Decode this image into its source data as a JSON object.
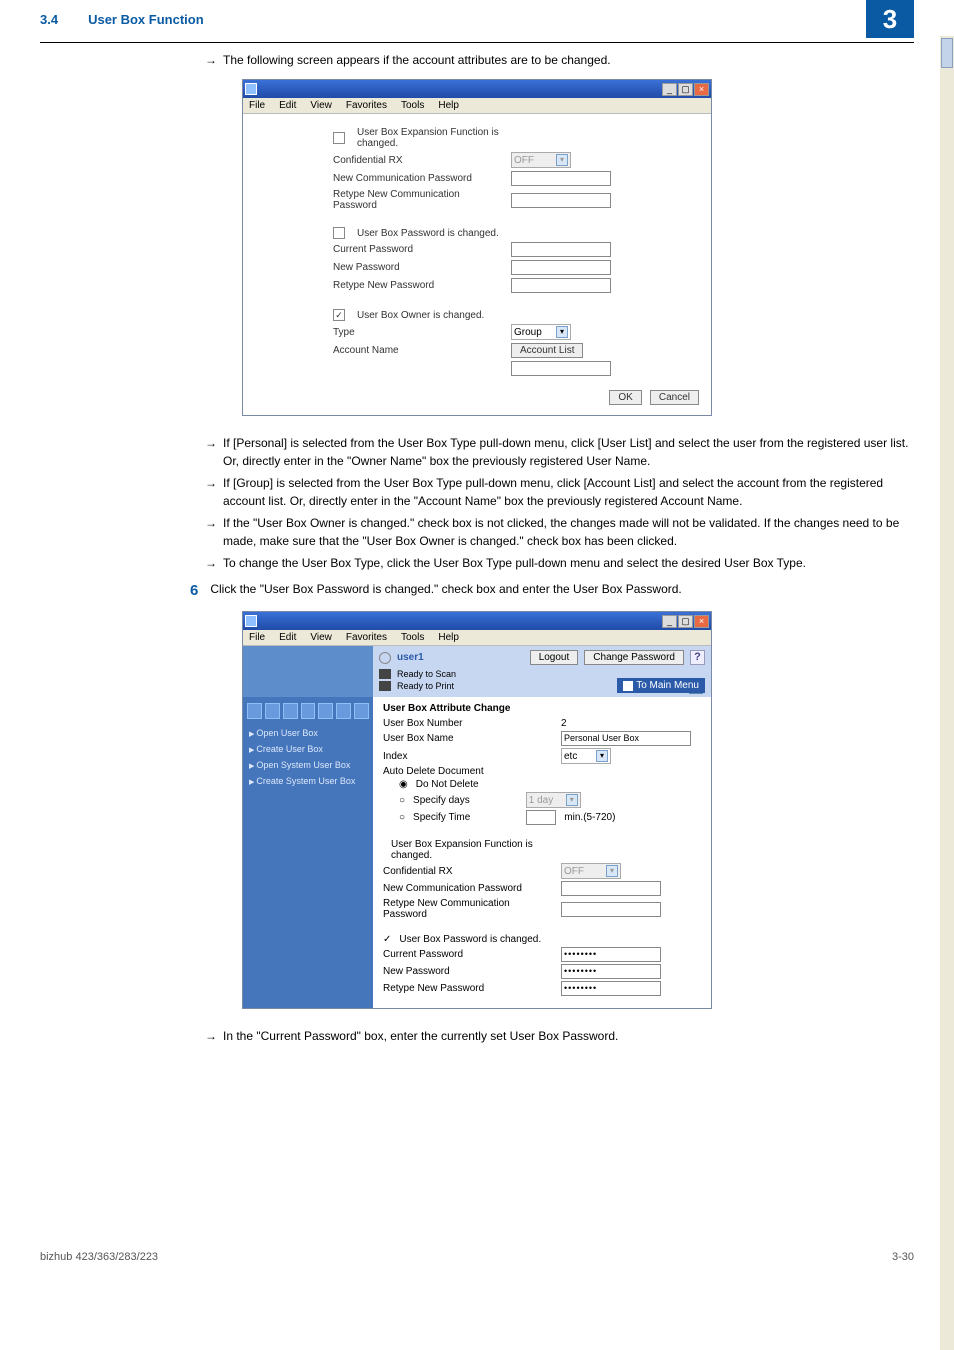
{
  "header": {
    "section": "3.4",
    "title": "User Box Function",
    "chapter": "3"
  },
  "intro_note": "The following screen appears if the account attributes are to be changed.",
  "winbar": {
    "min": "_",
    "max": "▢",
    "close": "×"
  },
  "menu": {
    "file": "File",
    "edit": "Edit",
    "view": "View",
    "favorites": "Favorites",
    "tools": "Tools",
    "help": "Help"
  },
  "dialog1": {
    "sectA": {
      "hdr": "User Box Expansion Function is changed.",
      "l1": "Confidential RX",
      "v1": "OFF",
      "l2": "New Communication Password",
      "l3": "Retype New Communication Password"
    },
    "sectB": {
      "hdr": "User Box Password is changed.",
      "l1": "Current Password",
      "l2": "New Password",
      "l3": "Retype New Password"
    },
    "sectC": {
      "hdr": "User Box Owner is changed.",
      "checked": "✓",
      "l1": "Type",
      "v1": "Group",
      "l2": "Account Name",
      "btn": "Account List"
    },
    "ok": "OK",
    "cancel": "Cancel"
  },
  "bullets": {
    "b1": "If [Personal] is selected from the User Box Type pull-down menu, click [User List] and select the user from the registered user list. Or, directly enter in the \"Owner Name\" box the previously registered User Name.",
    "b2": "If [Group] is selected from the User Box Type pull-down menu, click [Account List] and select the account from the registered account list. Or, directly enter in the \"Account Name\" box the previously registered Account Name.",
    "b3": "If the \"User Box Owner is changed.\" check box is not clicked, the changes made will not be validated. If the changes need to be made, make sure that the \"User Box Owner is changed.\" check box has been clicked.",
    "b4": "To change the User Box Type, click the User Box Type pull-down menu and select the desired User Box Type."
  },
  "step": {
    "num": "6",
    "text": "Click the \"User Box Password is changed.\" check box and enter the User Box Password."
  },
  "dialog2": {
    "user": "user1",
    "logout": "Logout",
    "chpwd": "Change Password",
    "status1": "Ready to Scan",
    "status2": "Ready to Print",
    "tomain": "To Main Menu",
    "sidebar": {
      "s1": "Open User Box",
      "s2": "Create User Box",
      "s3": "Open System User Box",
      "s4": "Create System User Box"
    },
    "main": {
      "title": "User Box Attribute Change",
      "l1": "User Box Number",
      "v1": "2",
      "l2": "User Box Name",
      "v2": "Personal User Box",
      "l3": "Index",
      "v3": "etc",
      "l4": "Auto Delete Document",
      "r1": "Do Not Delete",
      "r2": "Specify days",
      "r2v": "1 day",
      "r3": "Specify Time",
      "r3v": "",
      "r3u": "min.(5-720)"
    },
    "sectA": {
      "hdr": "User Box Expansion Function is changed.",
      "l1": "Confidential RX",
      "v1": "OFF",
      "l2": "New Communication Password",
      "l3": "Retype New Communication Password"
    },
    "sectB": {
      "hdr": "User Box Password is changed.",
      "checked": "✓",
      "l1": "Current Password",
      "v1": "••••••••",
      "l2": "New Password",
      "v2": "••••••••",
      "l3": "Retype New Password",
      "v3": "••••••••"
    }
  },
  "postnote": "In the \"Current Password\" box, enter the currently set User Box Password.",
  "footer": {
    "model": "bizhub 423/363/283/223",
    "page": "3-30"
  }
}
